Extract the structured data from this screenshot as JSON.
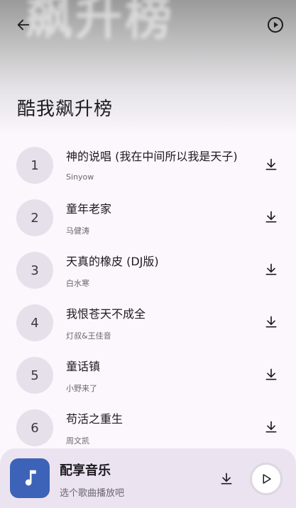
{
  "header": {
    "background_text": "飙升榜",
    "title": "酷我飙升榜",
    "back_icon": "arrow-left-icon",
    "play_all_icon": "play-circle-icon"
  },
  "songs": [
    {
      "rank": "1",
      "title": "神的说唱 (我在中间所以我是天子)",
      "artist": "Sinyow"
    },
    {
      "rank": "2",
      "title": "童年老家",
      "artist": "马健涛"
    },
    {
      "rank": "3",
      "title": "天真的橡皮 (DJ版)",
      "artist": "白水寒"
    },
    {
      "rank": "4",
      "title": "我恨苍天不成全",
      "artist": "灯叔&王佳音"
    },
    {
      "rank": "5",
      "title": "童话镇",
      "artist": "小野来了"
    },
    {
      "rank": "6",
      "title": "苟活之重生",
      "artist": "周文凯"
    }
  ],
  "player": {
    "title": "配享音乐",
    "subtitle": "选个歌曲播放吧",
    "cover_icon": "music-note-icon",
    "download_icon": "download-icon",
    "play_icon": "play-icon"
  },
  "colors": {
    "background": "#fbf7fd",
    "rank_circle": "#e6e0eb",
    "player_bar": "#ebe4f0",
    "cover": "#3d63b8"
  }
}
